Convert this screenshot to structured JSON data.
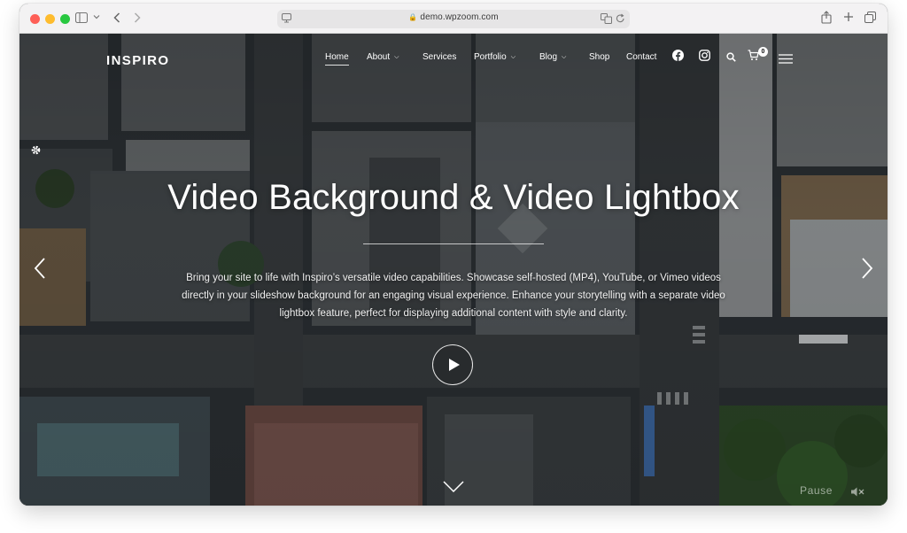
{
  "browser": {
    "url": "demo.wpzoom.com"
  },
  "site": {
    "logo": "INSPIRO",
    "nav": [
      {
        "label": "Home",
        "has_caret": false,
        "active": true
      },
      {
        "label": "About",
        "has_caret": true,
        "active": false
      },
      {
        "label": "Services",
        "has_caret": false,
        "active": false
      },
      {
        "label": "Portfolio",
        "has_caret": true,
        "active": false
      },
      {
        "label": "Blog",
        "has_caret": true,
        "active": false
      },
      {
        "label": "Shop",
        "has_caret": false,
        "active": false
      },
      {
        "label": "Contact",
        "has_caret": false,
        "active": false
      }
    ],
    "icons": [
      "facebook-icon",
      "instagram-icon",
      "search-icon",
      "cart-icon",
      "hamburger-menu-icon"
    ],
    "cart_count": "0"
  },
  "hero": {
    "headline": "Video Background & Video Lightbox",
    "subtitle": "Bring your site to life with Inspiro’s versatile video capabilities. Showcase self-hosted (MP4), YouTube, or Vimeo videos directly in your slideshow background for an engaging visual experience. Enhance your storytelling with a separate video lightbox feature, perfect for displaying additional content with style and clarity.",
    "pause_label": "Pause",
    "accent_color": "#ffffff"
  }
}
